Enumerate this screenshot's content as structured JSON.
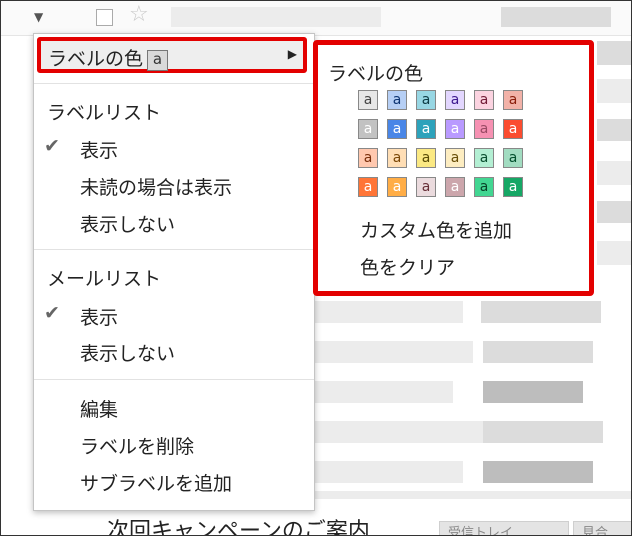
{
  "background": {
    "bottom_text": "次回キャンペーンのご案内",
    "bottom_button_1": "受信トレイ",
    "bottom_button_2": "見合"
  },
  "menu": {
    "label_color": {
      "label": "ラベルの色",
      "swatch_letter": "a"
    },
    "label_list": {
      "heading": "ラベルリスト",
      "options": [
        {
          "label": "表示",
          "checked": true
        },
        {
          "label": "未読の場合は表示",
          "checked": false
        },
        {
          "label": "表示しない",
          "checked": false
        }
      ]
    },
    "mail_list": {
      "heading": "メールリスト",
      "options": [
        {
          "label": "表示",
          "checked": true
        },
        {
          "label": "表示しない",
          "checked": false
        }
      ]
    },
    "actions": [
      "編集",
      "ラベルを削除",
      "サブラベルを追加"
    ]
  },
  "submenu": {
    "title": "ラベルの色",
    "swatch_letter": "a",
    "swatches": [
      [
        {
          "bg": "#e7e7e7",
          "fg": "#444444"
        },
        {
          "bg": "#b6cff5",
          "fg": "#0d3472"
        },
        {
          "bg": "#98d7e4",
          "fg": "#0d3b44"
        },
        {
          "bg": "#e3d7ff",
          "fg": "#3d188e"
        },
        {
          "bg": "#fbd3e0",
          "fg": "#711a36"
        },
        {
          "bg": "#f2b2a8",
          "fg": "#8a1c0a"
        }
      ],
      [
        {
          "bg": "#c2c2c2",
          "fg": "#ffffff"
        },
        {
          "bg": "#4986e7",
          "fg": "#ffffff"
        },
        {
          "bg": "#2da2bb",
          "fg": "#ffffff"
        },
        {
          "bg": "#b99aff",
          "fg": "#ffffff"
        },
        {
          "bg": "#f691b2",
          "fg": "#994a64"
        },
        {
          "bg": "#fb4c2f",
          "fg": "#ffffff"
        }
      ],
      [
        {
          "bg": "#ffc8af",
          "fg": "#7a2e0b"
        },
        {
          "bg": "#ffdeb5",
          "fg": "#7a4706"
        },
        {
          "bg": "#fbe983",
          "fg": "#594c05"
        },
        {
          "bg": "#fdedc1",
          "fg": "#684e07"
        },
        {
          "bg": "#b3efd3",
          "fg": "#0b4f30"
        },
        {
          "bg": "#a2dcc1",
          "fg": "#04502e"
        }
      ],
      [
        {
          "bg": "#ff7537",
          "fg": "#ffffff"
        },
        {
          "bg": "#ffad46",
          "fg": "#ffffff"
        },
        {
          "bg": "#ebdbde",
          "fg": "#662e37"
        },
        {
          "bg": "#cca6ac",
          "fg": "#ffffff"
        },
        {
          "bg": "#42d692",
          "fg": "#094228"
        },
        {
          "bg": "#16a765",
          "fg": "#ffffff"
        }
      ]
    ],
    "add_custom": "カスタム色を追加",
    "clear": "色をクリア"
  },
  "colors": {
    "highlight_border": "#e30000"
  }
}
